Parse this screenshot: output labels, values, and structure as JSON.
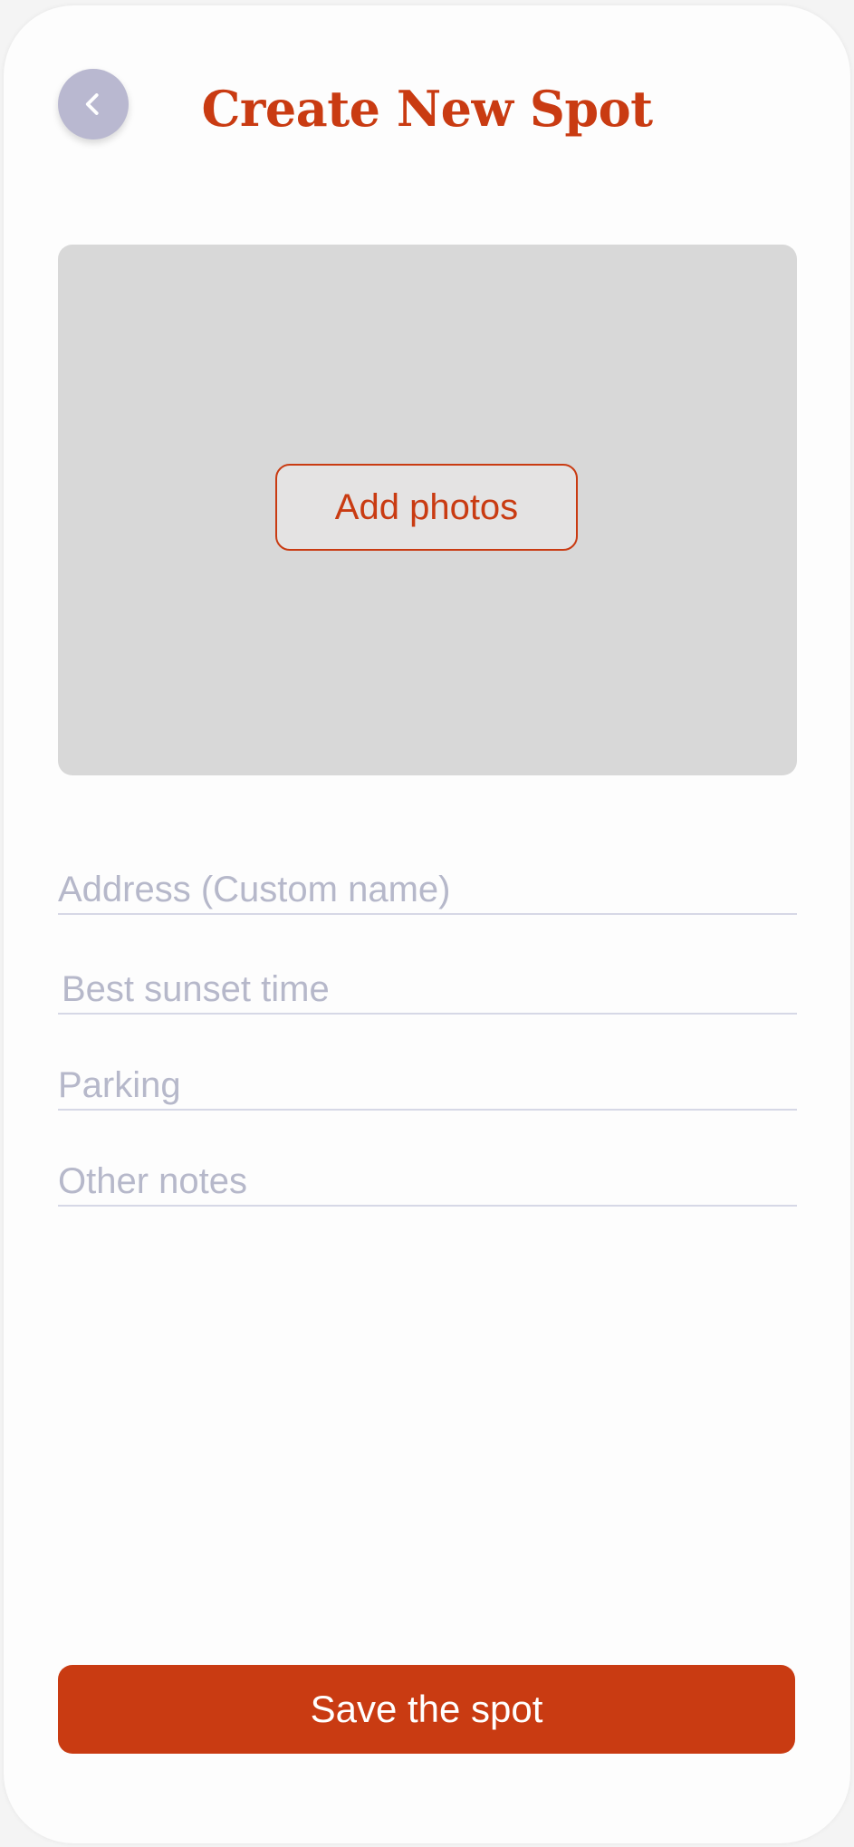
{
  "header": {
    "title": "Create New Spot",
    "back_icon": "chevron-left-icon"
  },
  "photos": {
    "add_label": "Add photos"
  },
  "form": {
    "fields": [
      {
        "id": "address",
        "placeholder": "Address (Custom name)",
        "value": ""
      },
      {
        "id": "sunset",
        "placeholder": "Best sunset time",
        "value": ""
      },
      {
        "id": "parking",
        "placeholder": "Parking",
        "value": ""
      },
      {
        "id": "notes",
        "placeholder": "Other notes",
        "value": ""
      }
    ]
  },
  "actions": {
    "save_label": "Save the spot"
  },
  "colors": {
    "accent": "#c93b12",
    "back_button": "#b9b8d0",
    "photo_area": "#d8d8d8",
    "placeholder": "#b6b8ca",
    "divider": "#d6d8e6"
  }
}
